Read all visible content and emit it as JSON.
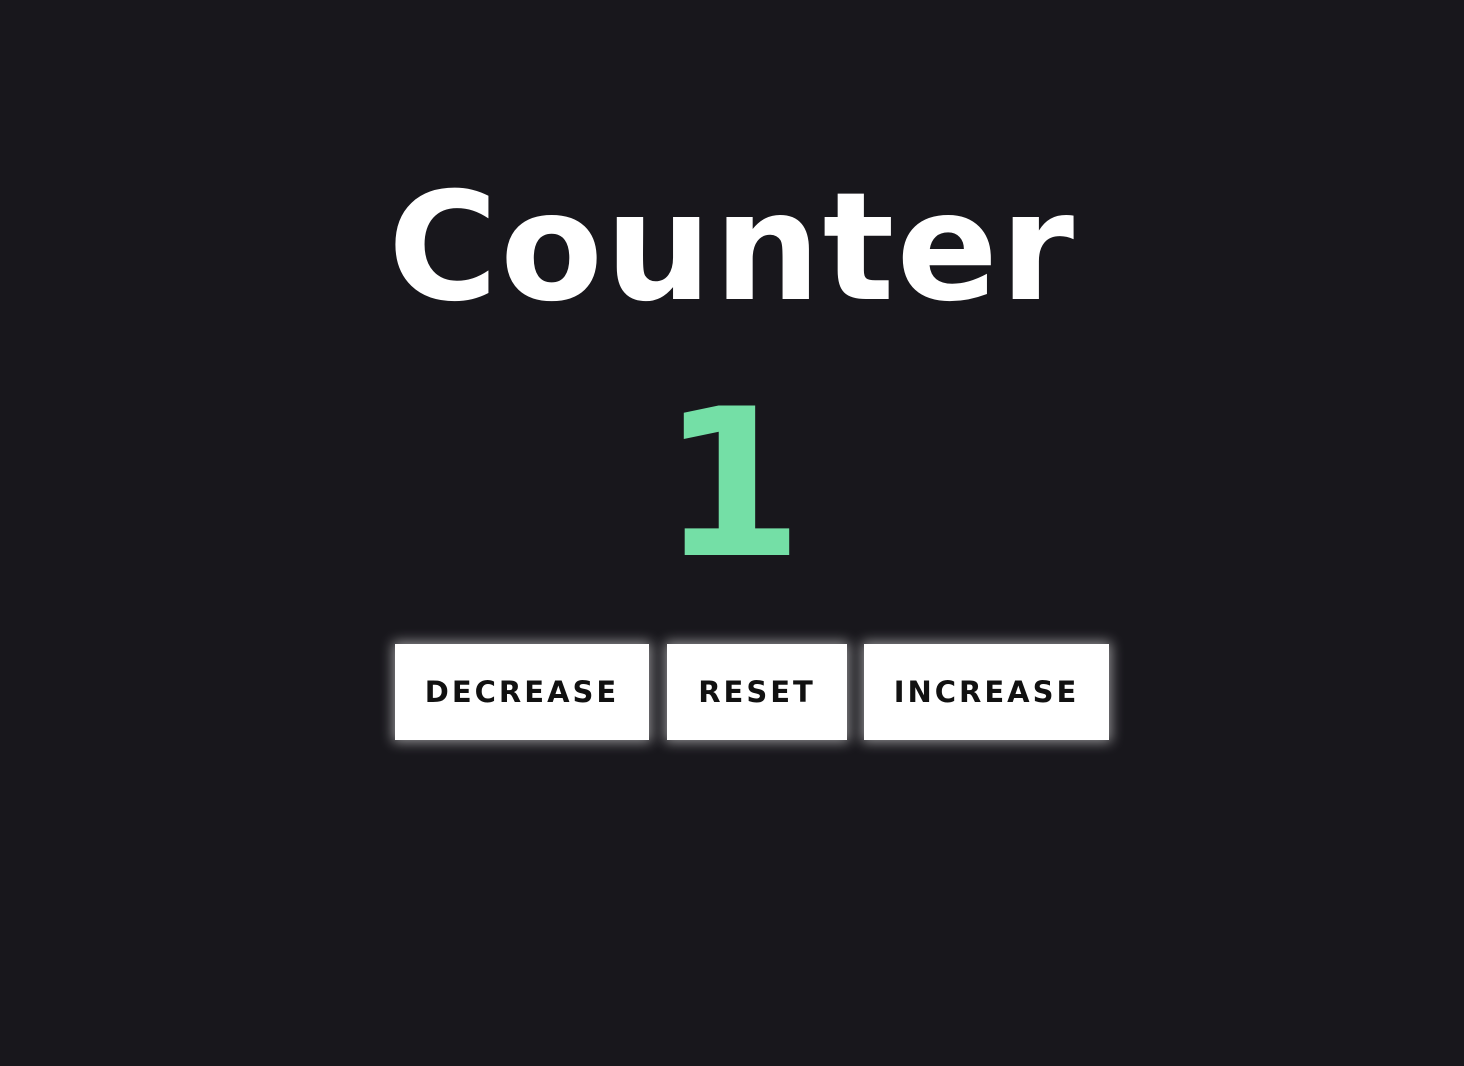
{
  "app": {
    "title": "Counter",
    "count": "1",
    "buttons": {
      "decrease_label": "DECREASE",
      "reset_label": "RESET",
      "increase_label": "INCREASE"
    }
  },
  "colors": {
    "background": "#18171c",
    "title": "#ffffff",
    "count": "#74dfa6",
    "button_background": "#ffffff",
    "button_text": "#111111"
  }
}
